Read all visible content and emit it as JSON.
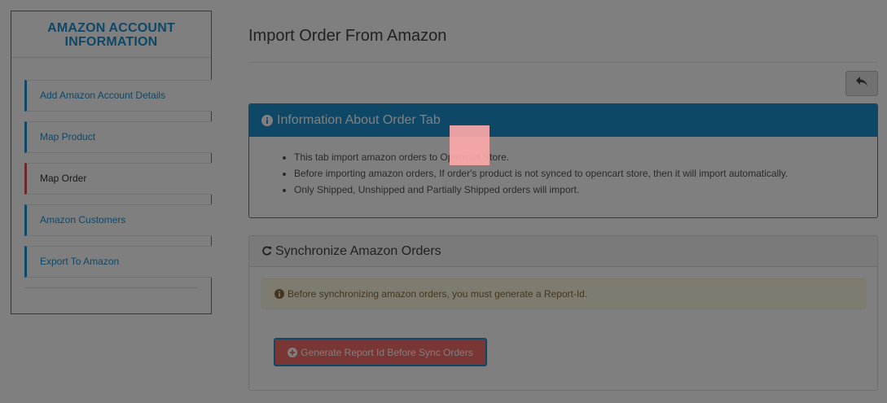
{
  "sidebar": {
    "title": "AMAZON ACCOUNT INFORMATION",
    "items": [
      {
        "label": "Add Amazon Account Details"
      },
      {
        "label": "Map Product"
      },
      {
        "label": "Map Order"
      },
      {
        "label": "Amazon Customers"
      },
      {
        "label": "Export To Amazon"
      }
    ]
  },
  "header": {
    "title": "Import Order From Amazon",
    "back_icon": "reply-icon"
  },
  "info_panel": {
    "title": "Information About Order Tab",
    "icon": "info-circle-icon",
    "bullets": [
      "This tab import amazon orders to Opencart Store.",
      "Before importing amazon orders, If order's product is not synced to opencart store, then it will import automatically.",
      "Only Shipped, Unshipped and Partially Shipped orders will import."
    ]
  },
  "sync_panel": {
    "title": "Synchronize Amazon Orders",
    "icon": "refresh-icon",
    "warning": "Before synchronizing amazon orders, you must generate a Report-Id.",
    "button_label": "Generate Report Id Before Sync Orders"
  },
  "colors": {
    "primary": "#1e91cf",
    "active_marker": "#d9534f",
    "button": "#f56b6b",
    "highlight": "#ffaaaa"
  }
}
